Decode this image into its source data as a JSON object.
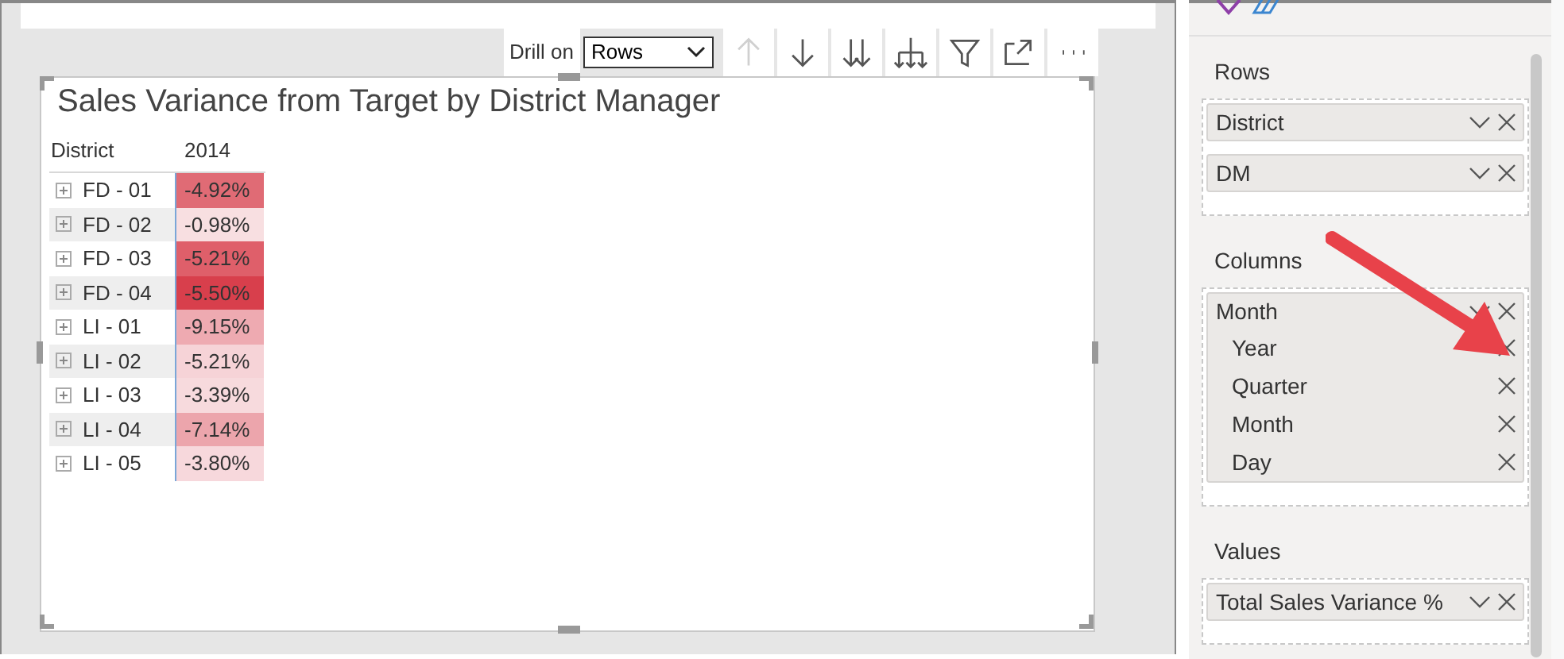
{
  "toolbar": {
    "drill_label": "Drill on",
    "drill_value": "Rows",
    "buttons": [
      {
        "kind": "up",
        "disabled": true
      },
      {
        "kind": "down",
        "disabled": false
      },
      {
        "kind": "down-all",
        "disabled": false
      },
      {
        "kind": "expand",
        "disabled": false
      },
      {
        "kind": "filter",
        "disabled": false
      },
      {
        "kind": "focus",
        "disabled": false
      },
      {
        "kind": "more",
        "disabled": false
      }
    ]
  },
  "visual": {
    "title": "Sales Variance from Target by District Manager",
    "columns": [
      "District",
      "2014"
    ],
    "rows": [
      {
        "district": "FD - 01",
        "value": "-4.92%",
        "color": "#e06b75"
      },
      {
        "district": "FD - 02",
        "value": "-0.98%",
        "color": "#f8dfe1"
      },
      {
        "district": "FD - 03",
        "value": "-5.21%",
        "color": "#df5f6a"
      },
      {
        "district": "FD - 04",
        "value": "-5.50%",
        "color": "#d83f4c"
      },
      {
        "district": "LI - 01",
        "value": "-9.15%",
        "color": "#eeaab1"
      },
      {
        "district": "LI - 02",
        "value": "-5.21%",
        "color": "#f6d3d7"
      },
      {
        "district": "LI - 03",
        "value": "-3.39%",
        "color": "#f7dadd"
      },
      {
        "district": "LI - 04",
        "value": "-7.14%",
        "color": "#eca5ac"
      },
      {
        "district": "LI - 05",
        "value": "-3.80%",
        "color": "#f7d8dc"
      }
    ]
  },
  "fields": {
    "sections": [
      {
        "label": "Rows",
        "items": [
          {
            "name": "District"
          },
          {
            "name": "DM"
          }
        ]
      },
      {
        "label": "Columns",
        "items": [
          {
            "name": "Month",
            "children": [
              "Year",
              "Quarter",
              "Month",
              "Day"
            ]
          }
        ]
      },
      {
        "label": "Values",
        "items": [
          {
            "name": "Total Sales Variance %"
          }
        ]
      }
    ]
  }
}
